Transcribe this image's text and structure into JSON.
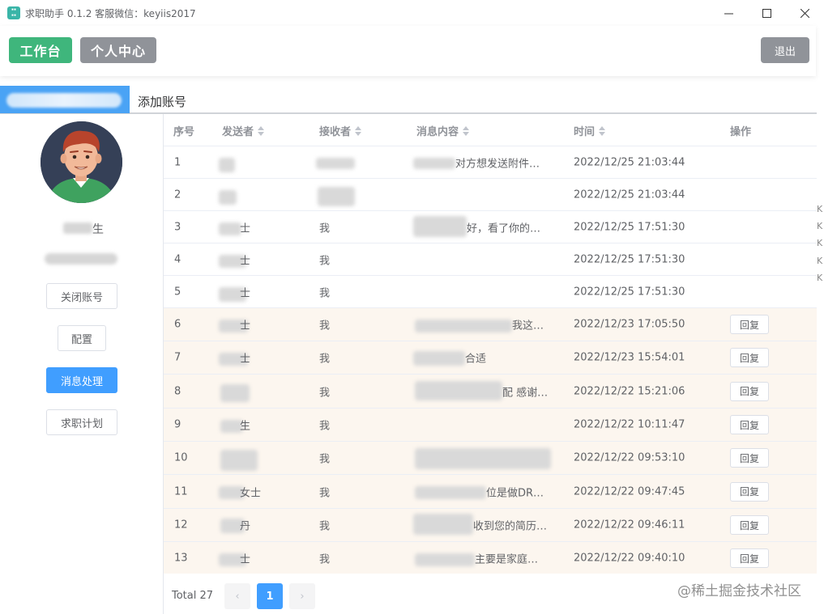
{
  "window": {
    "title": "求职助手 0.1.2 客服微信：keyiis2017",
    "minimize_icon": "minimize-icon",
    "maximize_icon": "maximize-icon",
    "close_icon": "close-icon"
  },
  "header": {
    "workspace_label": "工作台",
    "profile_label": "个人中心",
    "logout_label": "退出"
  },
  "accounts": {
    "add_label": "添加账号"
  },
  "sidebar": {
    "name_suffix": "生",
    "buttons": [
      "关闭账号",
      "配置",
      "消息处理",
      "求职计划"
    ],
    "active_index": 2
  },
  "table": {
    "headers": {
      "index": "序号",
      "sender": "发送者",
      "receiver": "接收者",
      "content": "消息内容",
      "time": "时间",
      "action": "操作"
    },
    "reply_label": "回复",
    "rows": [
      {
        "index": "1",
        "sender": "",
        "receiver": "",
        "content": "对方想发送附件…",
        "time": "2022/12/25 21:03:44",
        "reply": false,
        "highlight": false
      },
      {
        "index": "2",
        "sender": "",
        "receiver": "",
        "content": "",
        "time": "2022/12/25 21:03:44",
        "reply": false,
        "highlight": false
      },
      {
        "index": "3",
        "sender": "士",
        "receiver": "我",
        "content": "好，看了你的…",
        "time": "2022/12/25 17:51:30",
        "reply": false,
        "highlight": false
      },
      {
        "index": "4",
        "sender": "士",
        "receiver": "我",
        "content": "",
        "time": "2022/12/25 17:51:30",
        "reply": false,
        "highlight": false
      },
      {
        "index": "5",
        "sender": "士",
        "receiver": "我",
        "content": "",
        "time": "2022/12/25 17:51:30",
        "reply": false,
        "highlight": false
      },
      {
        "index": "6",
        "sender": "士",
        "receiver": "我",
        "content": "我这…",
        "time": "2022/12/23 17:05:50",
        "reply": true,
        "highlight": true
      },
      {
        "index": "7",
        "sender": "士",
        "receiver": "我",
        "content": "合适",
        "time": "2022/12/23 15:54:01",
        "reply": true,
        "highlight": true
      },
      {
        "index": "8",
        "sender": "",
        "receiver": "我",
        "content": "配 感谢…",
        "time": "2022/12/22 15:21:06",
        "reply": true,
        "highlight": true
      },
      {
        "index": "9",
        "sender": "生",
        "receiver": "我",
        "content": "",
        "time": "2022/12/22 10:11:47",
        "reply": true,
        "highlight": true
      },
      {
        "index": "10",
        "sender": "",
        "receiver": "我",
        "content": "",
        "time": "2022/12/22 09:53:10",
        "reply": true,
        "highlight": true
      },
      {
        "index": "11",
        "sender": "女士",
        "receiver": "我",
        "content": "位是做DR…",
        "time": "2022/12/22 09:47:45",
        "reply": true,
        "highlight": true
      },
      {
        "index": "12",
        "sender": "丹",
        "receiver": "我",
        "content": "收到您的简历…",
        "time": "2022/12/22 09:46:11",
        "reply": true,
        "highlight": true
      },
      {
        "index": "13",
        "sender": "士",
        "receiver": "我",
        "content": "主要是家庭…",
        "time": "2022/12/22 09:40:10",
        "reply": true,
        "highlight": true
      }
    ]
  },
  "pagination": {
    "total": "Total 27",
    "current_page": "1",
    "prev_icon": "chevron-left-icon",
    "next_icon": "chevron-right-icon"
  },
  "edge_texts": [
    "K",
    "K",
    "K",
    "K",
    "K"
  ],
  "watermark": "@稀土掘金技术社区"
}
